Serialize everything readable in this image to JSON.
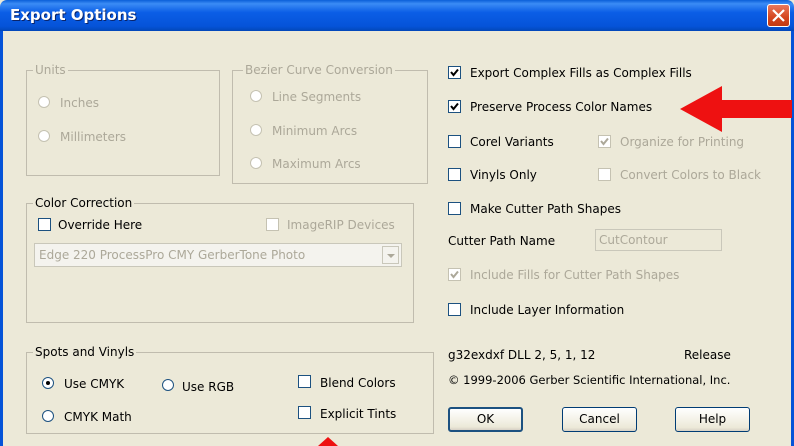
{
  "window": {
    "title": "Export Options",
    "close_icon": "close-icon"
  },
  "units": {
    "legend": "Units",
    "options": [
      {
        "label": "Inches",
        "checked": false,
        "enabled": false
      },
      {
        "label": "Millimeters",
        "checked": false,
        "enabled": false
      }
    ]
  },
  "bezier": {
    "legend": "Bezier Curve Conversion",
    "options": [
      {
        "label": "Line Segments",
        "checked": false,
        "enabled": false
      },
      {
        "label": "Minimum Arcs",
        "checked": false,
        "enabled": false
      },
      {
        "label": "Maximum Arcs",
        "checked": false,
        "enabled": false
      }
    ]
  },
  "color_correction": {
    "legend": "Color Correction",
    "override_label": "Override Here",
    "override_checked": false,
    "imagerip_label": "ImageRIP Devices",
    "imagerip_checked": false,
    "profile_value": "Edge 220 ProcessPro CMY GerberTone Photo"
  },
  "spots": {
    "legend": "Spots and Vinyls",
    "use_cmyk_label": "Use CMYK",
    "use_cmyk_checked": true,
    "use_rgb_label": "Use RGB",
    "use_rgb_checked": false,
    "cmyk_math_label": "CMYK Math",
    "cmyk_math_checked": false,
    "blend_label": "Blend Colors",
    "blend_checked": false,
    "tints_label": "Explicit Tints",
    "tints_checked": false
  },
  "options": {
    "complex_fills_label": "Export Complex Fills as Complex Fills",
    "complex_fills_checked": true,
    "preserve_label": "Preserve Process Color Names",
    "preserve_checked": true,
    "corel_label": "Corel Variants",
    "corel_checked": false,
    "organize_label": "Organize for Printing",
    "organize_checked": true,
    "vinyls_label": "Vinyls Only",
    "vinyls_checked": false,
    "convert_label": "Convert Colors to Black",
    "convert_checked": false,
    "cutter_label": "Make Cutter Path Shapes",
    "cutter_checked": false,
    "cutter_name_label": "Cutter Path Name",
    "cutter_name_value": "CutContour",
    "include_fills_label": "Include Fills for Cutter Path Shapes",
    "include_fills_checked": true,
    "layer_label": "Include Layer Information",
    "layer_checked": false
  },
  "info": {
    "version": "g32exdxf DLL 2, 5, 1, 12",
    "release": "Release",
    "copyright": "© 1999-2006 Gerber Scientific International, Inc."
  },
  "buttons": {
    "ok": "OK",
    "cancel": "Cancel",
    "help": "Help"
  },
  "colors": {
    "titlebar": "#0553d8",
    "dialog_bg": "#ece9d8",
    "disabled_text": "#aca899",
    "annotation_arrow": "#ee1111"
  }
}
